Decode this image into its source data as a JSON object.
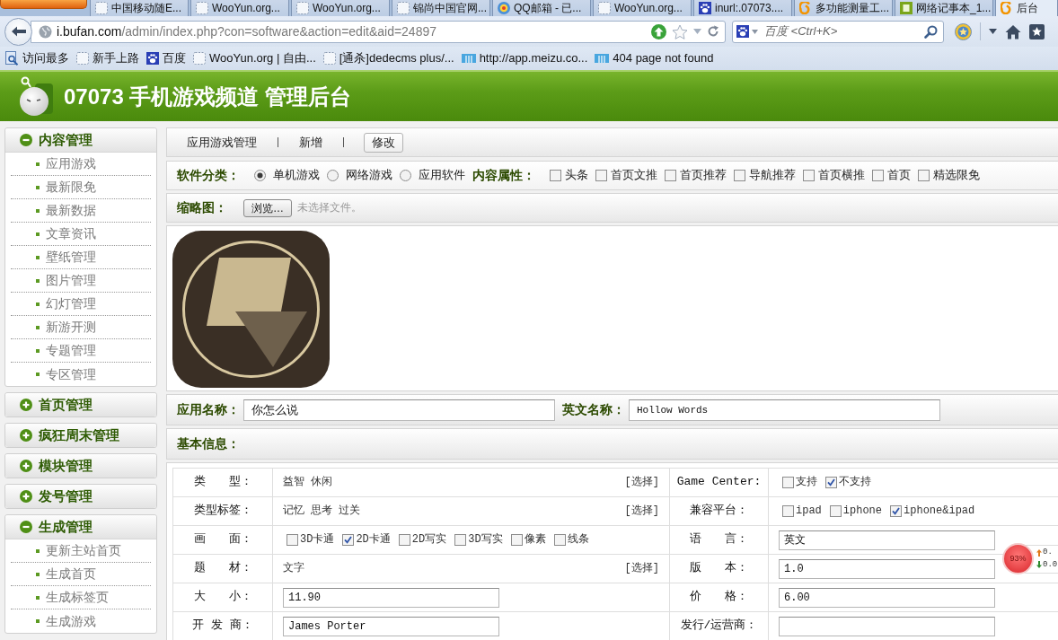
{
  "browser": {
    "tabs": [
      {
        "title": "中国移动随E...",
        "selected": false
      },
      {
        "title": "WooYun.org...",
        "selected": false
      },
      {
        "title": "WooYun.org...",
        "selected": false
      },
      {
        "title": "锦尚中国官网...",
        "selected": false
      },
      {
        "title": "QQ邮箱 - 已...",
        "selected": false
      },
      {
        "title": "WooYun.org...",
        "selected": false
      },
      {
        "title": "inurl:.07073....",
        "selected": false
      },
      {
        "title": "多功能测量工...",
        "selected": false
      },
      {
        "title": "网络记事本_1...",
        "selected": false
      },
      {
        "title": "后台",
        "selected": true
      }
    ],
    "address": {
      "host": "i.bufan.com",
      "path": "/admin/index.php?con=software&action=edit&aid=24897"
    },
    "search": {
      "placeholder": "百度 <Ctrl+K>"
    },
    "bookmarks": [
      {
        "label": "访问最多"
      },
      {
        "label": "新手上路"
      },
      {
        "label": "百度"
      },
      {
        "label": "WooYun.org | 自由..."
      },
      {
        "label": "[通杀]dedecms plus/..."
      },
      {
        "label": "http://app.meizu.co..."
      },
      {
        "label": "404 page not found"
      }
    ]
  },
  "header": {
    "title": "07073 手机游戏频道 管理后台"
  },
  "sidebar": {
    "sections": [
      {
        "title": "内容管理",
        "expanded": true,
        "items": [
          "应用游戏",
          "最新限免",
          "最新数据",
          "文章资讯",
          "壁纸管理",
          "图片管理",
          "幻灯管理",
          "新游开测",
          "专题管理",
          "专区管理"
        ]
      },
      {
        "title": "首页管理",
        "expanded": false
      },
      {
        "title": "疯狂周末管理",
        "expanded": false
      },
      {
        "title": "模块管理",
        "expanded": false
      },
      {
        "title": "发号管理",
        "expanded": false
      },
      {
        "title": "生成管理",
        "expanded": true,
        "items": [
          "更新主站首页",
          "生成首页",
          "生成标签页",
          "生成游戏"
        ]
      }
    ]
  },
  "toolbar": {
    "links": [
      {
        "label": "应用游戏管理",
        "selected": false
      },
      {
        "label": "新增",
        "selected": false
      },
      {
        "label": "修改",
        "selected": true
      }
    ]
  },
  "category": {
    "label": "软件分类：",
    "options": [
      {
        "label": "单机游戏",
        "selected": true
      },
      {
        "label": "网络游戏",
        "selected": false
      },
      {
        "label": "应用软件",
        "selected": false
      }
    ]
  },
  "attributes": {
    "label": "内容属性：",
    "options": [
      {
        "label": "头条",
        "checked": false
      },
      {
        "label": "首页文推",
        "checked": false
      },
      {
        "label": "首页推荐",
        "checked": false
      },
      {
        "label": "导航推荐",
        "checked": false
      },
      {
        "label": "首页横推",
        "checked": false
      },
      {
        "label": "首页",
        "checked": false
      },
      {
        "label": "精选限免",
        "checked": false
      }
    ]
  },
  "thumbnail": {
    "label": "缩略图：",
    "button": "浏览…",
    "status": "未选择文件。"
  },
  "names": {
    "app_name": {
      "label": "应用名称：",
      "value": "你怎么说"
    },
    "english_name": {
      "label": "英文名称：",
      "value": "Hollow Words"
    }
  },
  "basic_info": {
    "title": "基本信息：",
    "rows": [
      {
        "cells": [
          {
            "label": "类　　型：",
            "kind": "text",
            "value": "益智 休闲",
            "action": "[选择]"
          },
          {
            "label": "Game Center:",
            "kind": "checks",
            "options": [
              {
                "label": "支持",
                "checked": false
              },
              {
                "label": "不支持",
                "checked": true
              }
            ]
          }
        ]
      },
      {
        "cells": [
          {
            "label": "类型标签：",
            "kind": "text",
            "value": "记忆 思考 过关",
            "action": "[选择]"
          },
          {
            "label": "兼容平台：",
            "kind": "checks",
            "options": [
              {
                "label": "ipad",
                "checked": false
              },
              {
                "label": "iphone",
                "checked": false
              },
              {
                "label": "iphone&ipad",
                "checked": true
              }
            ]
          }
        ]
      },
      {
        "cells": [
          {
            "label": "画　　面：",
            "kind": "checks",
            "options": [
              {
                "label": "3D卡通",
                "checked": false
              },
              {
                "label": "2D卡通",
                "checked": true
              },
              {
                "label": "2D写实",
                "checked": false
              },
              {
                "label": "3D写实",
                "checked": false
              },
              {
                "label": "像素",
                "checked": false
              },
              {
                "label": "线条",
                "checked": false
              }
            ]
          },
          {
            "label": "语　　言：",
            "kind": "input",
            "value": "英文"
          }
        ]
      },
      {
        "cells": [
          {
            "label": "题　　材：",
            "kind": "text",
            "value": "文字",
            "action": "[选择]"
          },
          {
            "label": "版　　本：",
            "kind": "input",
            "value": "1.0"
          }
        ]
      },
      {
        "cells": [
          {
            "label": "大　　小：",
            "kind": "input",
            "value": "11.90"
          },
          {
            "label": "价　　格：",
            "kind": "input",
            "value": "6.00"
          }
        ]
      },
      {
        "cells": [
          {
            "label": "开 发 商：",
            "kind": "input",
            "value": "James Porter"
          },
          {
            "label": "发行/运营商：",
            "kind": "input"
          }
        ]
      }
    ]
  },
  "speed_ball": {
    "percent": "93%",
    "upload": "0.",
    "download": "0.0"
  }
}
